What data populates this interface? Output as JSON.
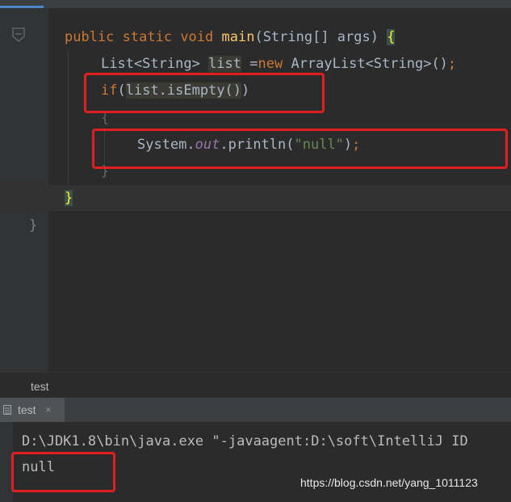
{
  "editor": {
    "lines": [
      {
        "id": "main",
        "segments": [
          {
            "t": "public ",
            "c": "kw"
          },
          {
            "t": "static ",
            "c": "kw"
          },
          {
            "t": "void ",
            "c": "kw"
          },
          {
            "t": "main",
            "c": "fn"
          },
          {
            "t": "(String[] args) ",
            "c": ""
          },
          {
            "t": "{",
            "c": "brace-hl"
          }
        ]
      },
      {
        "id": "decl",
        "segments": [
          {
            "t": "List<String> ",
            "c": ""
          },
          {
            "t": "list",
            "c": "hl"
          },
          {
            "t": " =",
            "c": ""
          },
          {
            "t": "new ",
            "c": "kw"
          },
          {
            "t": "ArrayList<String>()",
            "c": ""
          },
          {
            "t": ";",
            "c": "kw"
          }
        ]
      },
      {
        "id": "if",
        "segments": [
          {
            "t": "if",
            "c": "kw"
          },
          {
            "t": "(",
            "c": ""
          },
          {
            "t": "list.isEmpty()",
            "c": "hl"
          },
          {
            "t": ")",
            "c": ""
          }
        ]
      },
      {
        "id": "open",
        "segments": [
          {
            "t": "{",
            "c": ""
          }
        ]
      },
      {
        "id": "print",
        "segments": [
          {
            "t": "System.",
            "c": ""
          },
          {
            "t": "out",
            "c": "fld"
          },
          {
            "t": ".println(",
            "c": ""
          },
          {
            "t": "\"null\"",
            "c": "str"
          },
          {
            "t": ")",
            "c": ""
          },
          {
            "t": ";",
            "c": "kw"
          }
        ]
      },
      {
        "id": "close",
        "segments": [
          {
            "t": "}",
            "c": ""
          }
        ]
      },
      {
        "id": "end-main",
        "segments": [
          {
            "t": "}",
            "c": "brace-hl"
          }
        ]
      },
      {
        "id": "end-class",
        "segments": [
          {
            "t": "}",
            "c": ""
          }
        ]
      }
    ]
  },
  "breadcrumb": {
    "label": "test"
  },
  "run_panel": {
    "tab_label": "test",
    "close_glyph": "×",
    "tab_icon": "run-config-icon"
  },
  "console": {
    "command": "D:\\JDK1.8\\bin\\java.exe \"-javaagent:D:\\soft\\IntelliJ ID",
    "output": "null"
  },
  "watermark": "https://blog.csdn.net/yang_1011123",
  "colors": {
    "background": "#2b2b2b",
    "keyword": "#cc7832",
    "method": "#ffc66d",
    "string": "#6a8759",
    "field": "#9876aa",
    "annotation_box": "#e02020"
  }
}
